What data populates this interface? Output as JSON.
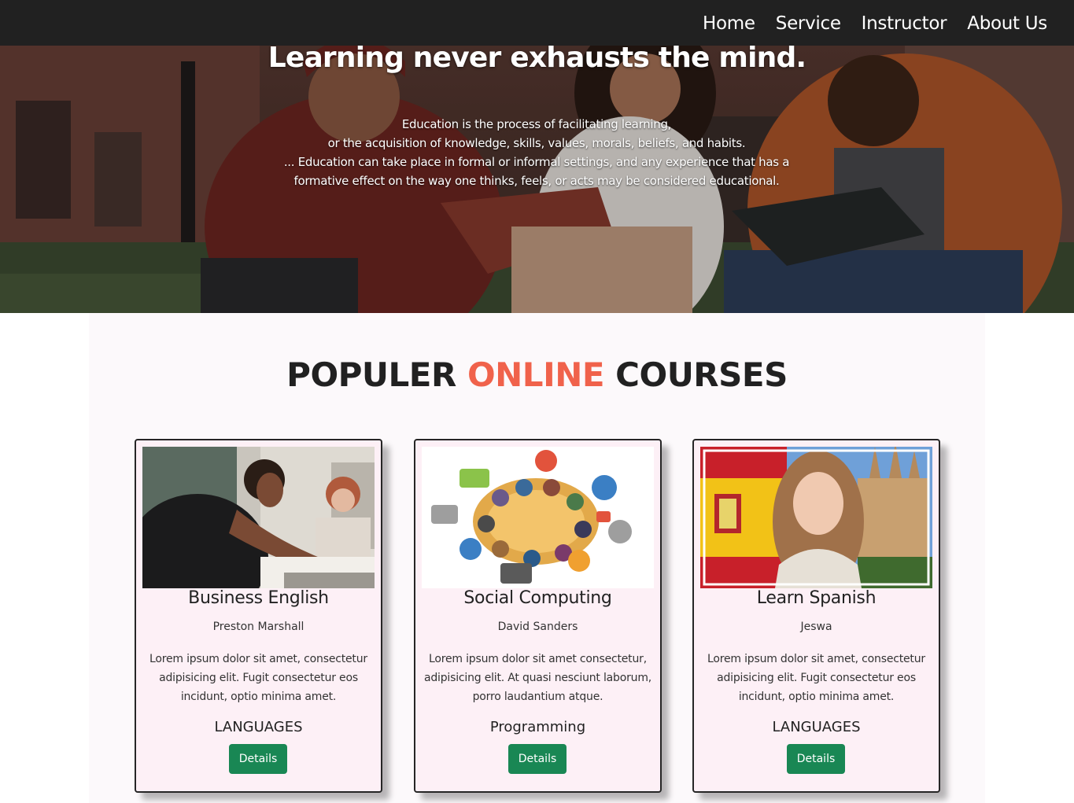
{
  "nav": {
    "items": [
      {
        "label": "Home"
      },
      {
        "label": "Service"
      },
      {
        "label": "Instructor"
      },
      {
        "label": "About Us"
      }
    ]
  },
  "hero": {
    "title": "Learning never exhausts the mind.",
    "lines": [
      "Education is the process of facilitating learning,",
      "or the acquisition of knowledge, skills, values, morals, beliefs, and habits.",
      "... Education can take place in formal or informal settings, and any experience that has a",
      "formative effect on the way one thinks, feels, or acts may be considered educational."
    ]
  },
  "section": {
    "title_part1": "POPULER ",
    "title_accent": "ONLINE",
    "title_part2": " COURSES",
    "accent_color": "#f0624b"
  },
  "courses": [
    {
      "title": "Business English",
      "instructor": "Preston Marshall",
      "description": "Lorem ipsum dolor sit amet, consectetur adipisicing elit. Fugit consectetur eos incidunt, optio minima amet.",
      "category": "LANGUAGES",
      "button_label": "Details",
      "image": "students-studying-photo"
    },
    {
      "title": "Social Computing",
      "instructor": "David Sanders",
      "description": "Lorem ipsum dolor sit amet consectetur, adipisicing elit. At quasi nesciunt laborum, porro laudantium atque.",
      "category": "Programming",
      "button_label": "Details",
      "image": "social-computing-illustration"
    },
    {
      "title": "Learn Spanish",
      "instructor": "Jeswa",
      "description": "Lorem ipsum dolor sit amet, consectetur adipisicing elit. Fugit consectetur eos incidunt, optio minima amet.",
      "category": "LANGUAGES",
      "button_label": "Details",
      "image": "spanish-flag-teacher-photo"
    }
  ],
  "colors": {
    "navbar": "#212121",
    "button": "#198754",
    "card_bg": "#fdf0f6",
    "section_bg": "#fcf9fb"
  }
}
